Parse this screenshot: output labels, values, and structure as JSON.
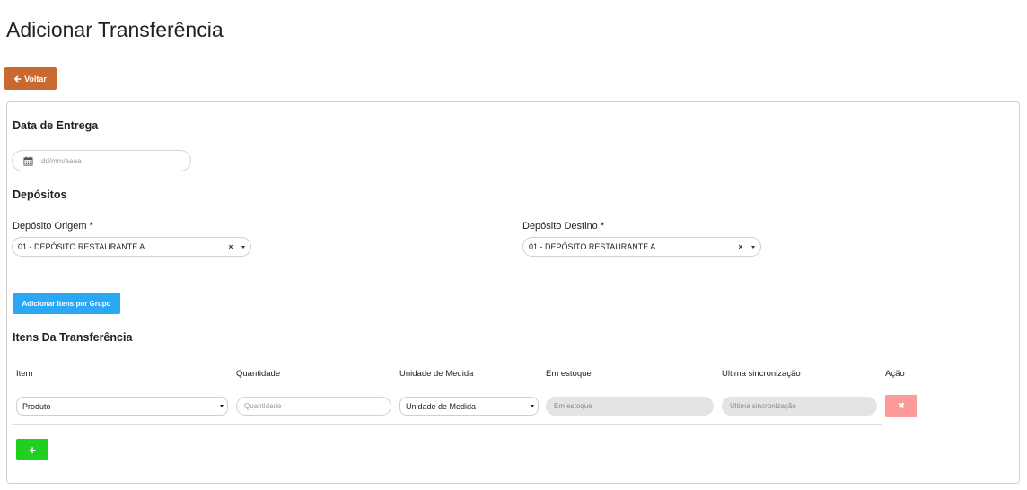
{
  "page": {
    "title": "Adicionar Transferência"
  },
  "toolbar": {
    "back_label": "Voltar"
  },
  "delivery": {
    "section_title": "Data de Entrega",
    "date_placeholder": "dd/mm/aaaa"
  },
  "deposits": {
    "section_title": "Depósitos",
    "origin_label": "Depósito Origem *",
    "origin_value": "01 - DEPÓSITO RESTAURANTE A",
    "destination_label": "Depósito Destino *",
    "destination_value": "01 - DEPÓSITO RESTAURANTE A",
    "clear_symbol": "×"
  },
  "group_button_label": "Adicionar Itens por Grupo",
  "items": {
    "section_title": "Itens Da Transferência",
    "columns": [
      "Item",
      "Quantidade",
      "Unidade de Medida",
      "Em estoque",
      "Ultima sincronização",
      "Ação"
    ],
    "row": {
      "item_value": "Produto",
      "quantity_placeholder": "Quantidade",
      "unit_value": "Unidade de Medida",
      "stock_placeholder": "Em estoque",
      "sync_placeholder": "Ultima sincronização",
      "remove_symbol": "✖"
    },
    "add_symbol": "+"
  },
  "colors": {
    "back_button": "#c8692f",
    "group_button": "#2aa7f5",
    "remove_button": "#fd9a9a",
    "add_button": "#1fd01f"
  }
}
